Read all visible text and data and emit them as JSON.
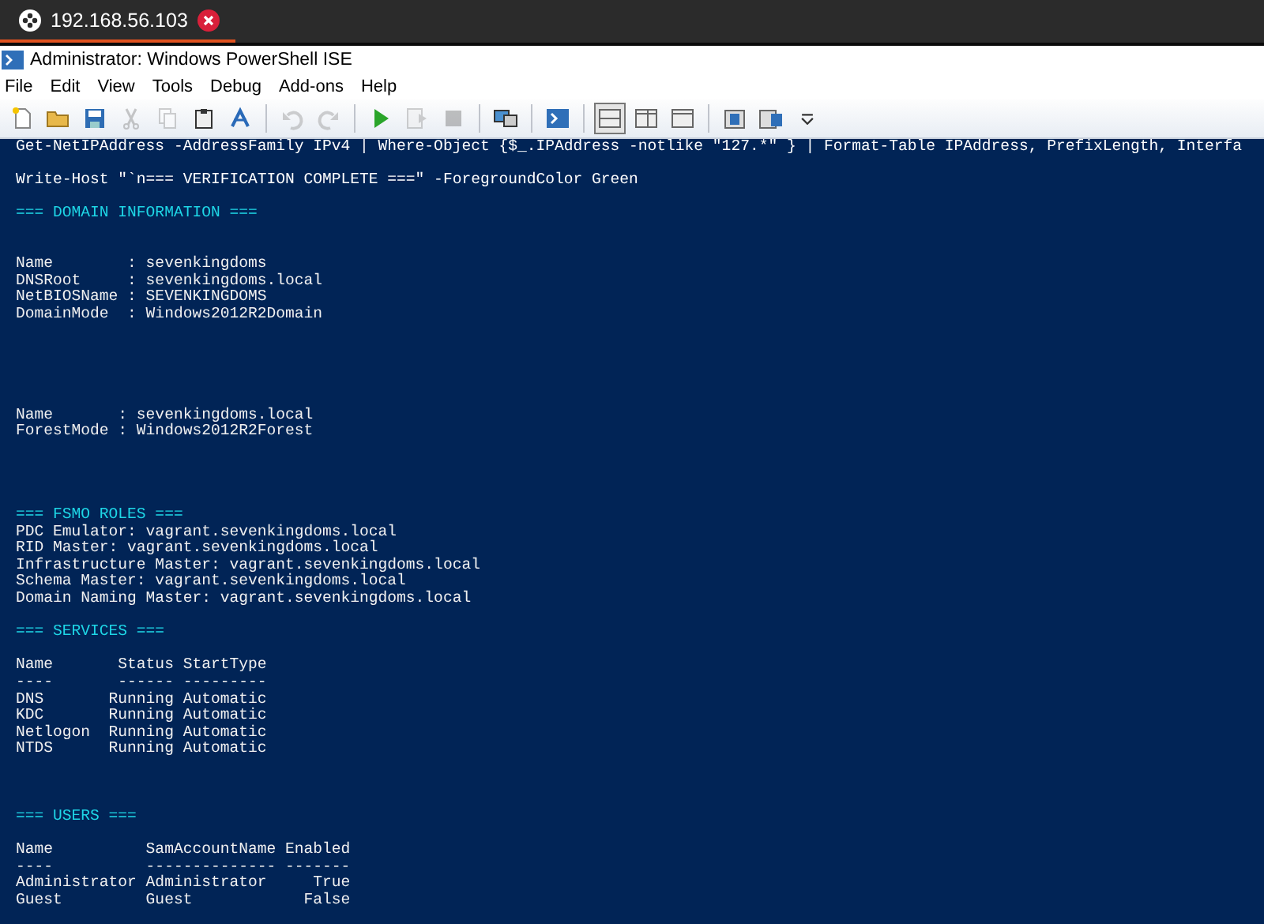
{
  "browser_tab": {
    "title": "192.168.56.103",
    "selected": true
  },
  "window": {
    "title": "Administrator: Windows PowerShell ISE"
  },
  "menu": [
    "File",
    "Edit",
    "View",
    "Tools",
    "Debug",
    "Add-ons",
    "Help"
  ],
  "toolbar": [
    {
      "kind": "new",
      "disabled": false
    },
    {
      "kind": "open",
      "disabled": false
    },
    {
      "kind": "save",
      "disabled": false
    },
    {
      "kind": "cut",
      "disabled": true
    },
    {
      "kind": "copy",
      "disabled": true
    },
    {
      "kind": "paste",
      "disabled": false
    },
    {
      "kind": "clear",
      "disabled": false
    },
    {
      "kind": "separator"
    },
    {
      "kind": "undo",
      "disabled": true
    },
    {
      "kind": "redo",
      "disabled": true
    },
    {
      "kind": "separator"
    },
    {
      "kind": "run",
      "disabled": false
    },
    {
      "kind": "run-selection",
      "disabled": true
    },
    {
      "kind": "stop",
      "disabled": true
    },
    {
      "kind": "separator"
    },
    {
      "kind": "remote",
      "disabled": false
    },
    {
      "kind": "separator"
    },
    {
      "kind": "console",
      "disabled": false
    },
    {
      "kind": "separator"
    }
  ],
  "layout_buttons": [
    {
      "kind": "top",
      "selected": true
    },
    {
      "kind": "right",
      "selected": false
    },
    {
      "kind": "max",
      "selected": false
    }
  ],
  "extra_toolbar": [
    {
      "kind": "show-script",
      "disabled": false
    },
    {
      "kind": "show-commands",
      "disabled": false
    },
    {
      "kind": "overflow",
      "disabled": false
    }
  ],
  "console": [
    {
      "kind": "command",
      "text": "Get-NetIPAddress -AddressFamily IPv4 | Where-Object {$_.IPAddress -notlike \"127.*\" } | Format-Table IPAddress, PrefixLength, Interfa"
    },
    {
      "kind": "blank"
    },
    {
      "kind": "command",
      "text": "Write-Host \"`n=== VERIFICATION COMPLETE ===\" -ForegroundColor Green"
    },
    {
      "kind": "blank"
    },
    {
      "kind": "heading",
      "text": "=== DOMAIN INFORMATION ==="
    },
    {
      "kind": "blank"
    },
    {
      "kind": "blank"
    },
    {
      "kind": "output",
      "text": "Name        : sevenkingdoms"
    },
    {
      "kind": "output",
      "text": "DNSRoot     : sevenkingdoms.local"
    },
    {
      "kind": "output",
      "text": "NetBIOSName : SEVENKINGDOMS"
    },
    {
      "kind": "output",
      "text": "DomainMode  : Windows2012R2Domain"
    },
    {
      "kind": "blank"
    },
    {
      "kind": "blank"
    },
    {
      "kind": "blank"
    },
    {
      "kind": "blank"
    },
    {
      "kind": "blank"
    },
    {
      "kind": "output",
      "text": "Name       : sevenkingdoms.local"
    },
    {
      "kind": "output",
      "text": "ForestMode : Windows2012R2Forest"
    },
    {
      "kind": "blank"
    },
    {
      "kind": "blank"
    },
    {
      "kind": "blank"
    },
    {
      "kind": "blank"
    },
    {
      "kind": "heading",
      "text": "=== FSMO ROLES ==="
    },
    {
      "kind": "output",
      "text": "PDC Emulator: vagrant.sevenkingdoms.local"
    },
    {
      "kind": "output",
      "text": "RID Master: vagrant.sevenkingdoms.local"
    },
    {
      "kind": "output",
      "text": "Infrastructure Master: vagrant.sevenkingdoms.local"
    },
    {
      "kind": "output",
      "text": "Schema Master: vagrant.sevenkingdoms.local"
    },
    {
      "kind": "output",
      "text": "Domain Naming Master: vagrant.sevenkingdoms.local"
    },
    {
      "kind": "blank"
    },
    {
      "kind": "heading",
      "text": "=== SERVICES ==="
    },
    {
      "kind": "blank"
    },
    {
      "kind": "output",
      "text": "Name       Status StartType"
    },
    {
      "kind": "output",
      "text": "----       ------ ---------"
    },
    {
      "kind": "output",
      "text": "DNS       Running Automatic"
    },
    {
      "kind": "output",
      "text": "KDC       Running Automatic"
    },
    {
      "kind": "output",
      "text": "Netlogon  Running Automatic"
    },
    {
      "kind": "output",
      "text": "NTDS      Running Automatic"
    },
    {
      "kind": "blank"
    },
    {
      "kind": "blank"
    },
    {
      "kind": "blank"
    },
    {
      "kind": "heading",
      "text": "=== USERS ==="
    },
    {
      "kind": "blank"
    },
    {
      "kind": "output",
      "text": "Name          SamAccountName Enabled"
    },
    {
      "kind": "output",
      "text": "----          -------------- -------"
    },
    {
      "kind": "output",
      "text": "Administrator Administrator     True"
    },
    {
      "kind": "output",
      "text": "Guest         Guest            False"
    }
  ]
}
